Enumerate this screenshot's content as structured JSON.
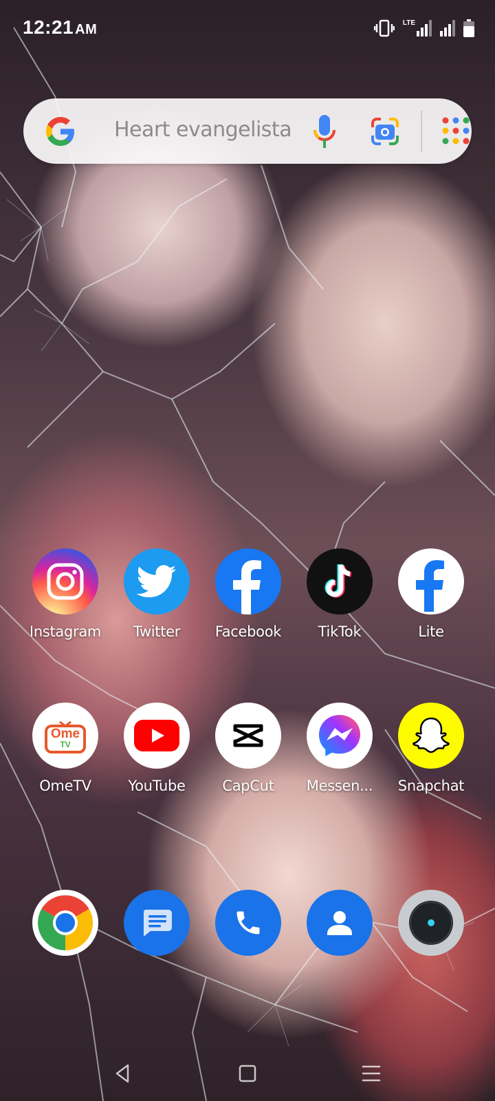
{
  "status_bar": {
    "time": "12:21",
    "ampm": "AM",
    "network_label": "LTE"
  },
  "search_bar": {
    "query": "Heart evangelista",
    "icons": [
      "google-logo",
      "mic-icon",
      "lens-icon",
      "app-grid-icon"
    ]
  },
  "apps_row1": [
    {
      "label": "Instagram",
      "icon": "instagram-icon"
    },
    {
      "label": "Twitter",
      "icon": "twitter-icon"
    },
    {
      "label": "Facebook",
      "icon": "facebook-icon"
    },
    {
      "label": "TikTok",
      "icon": "tiktok-icon"
    },
    {
      "label": "Lite",
      "icon": "facebook-lite-icon"
    }
  ],
  "apps_row2": [
    {
      "label": "OmeTV",
      "icon": "ometv-icon",
      "icon_text": "Ome",
      "icon_subtext": "TV"
    },
    {
      "label": "YouTube",
      "icon": "youtube-icon"
    },
    {
      "label": "CapCut",
      "icon": "capcut-icon"
    },
    {
      "label": "Messen...",
      "icon": "messenger-icon"
    },
    {
      "label": "Snapchat",
      "icon": "snapchat-icon"
    }
  ],
  "dock": [
    {
      "icon": "chrome-icon"
    },
    {
      "icon": "messages-icon"
    },
    {
      "icon": "phone-icon"
    },
    {
      "icon": "contacts-icon"
    },
    {
      "icon": "camera-icon"
    }
  ],
  "nav_bar": {
    "buttons": [
      "back-icon",
      "home-icon",
      "recents-icon"
    ]
  },
  "colors": {
    "facebook_blue": "#1877f2",
    "twitter_blue": "#1d9bf0",
    "youtube_red": "#ff0000",
    "snapchat_yellow": "#fffc00",
    "tiktok_bg": "#111111",
    "google_blue": "#1a73e8"
  }
}
